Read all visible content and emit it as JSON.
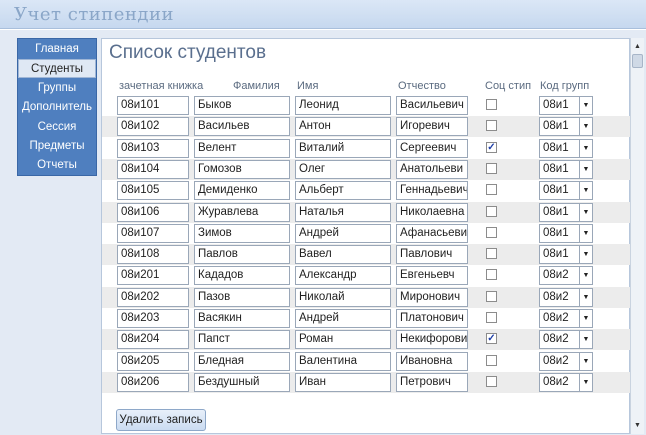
{
  "app": {
    "title": "Учет стипендии"
  },
  "nav": {
    "items": [
      {
        "label": "Главная",
        "active": false
      },
      {
        "label": "Студенты",
        "active": true
      },
      {
        "label": "Группы",
        "active": false
      },
      {
        "label": "Дополнитель",
        "active": false
      },
      {
        "label": "Сессия",
        "active": false
      },
      {
        "label": "Предметы",
        "active": false
      },
      {
        "label": "Отчеты",
        "active": false
      }
    ]
  },
  "form": {
    "title": "Список студентов",
    "columns": [
      "зачетная книжка",
      "Фамилия",
      "Имя",
      "Отчество",
      "Соц стип",
      "Код групп"
    ],
    "delete_label": "Удалить запись",
    "rows": [
      {
        "book": "08и101",
        "last": "Быков",
        "first": "Леонид",
        "middle": "Васильевич",
        "soc": false,
        "group": "08и1"
      },
      {
        "book": "08и102",
        "last": "Васильев",
        "first": "Антон",
        "middle": "Игоревич",
        "soc": false,
        "group": "08и1"
      },
      {
        "book": "08и103",
        "last": "Велент",
        "first": "Виталий",
        "middle": "Сергеевич",
        "soc": true,
        "group": "08и1"
      },
      {
        "book": "08и104",
        "last": "Гомозов",
        "first": "Олег",
        "middle": "Анатольеви",
        "soc": false,
        "group": "08и1"
      },
      {
        "book": "08и105",
        "last": "Демиденко",
        "first": "Альберт",
        "middle": "Геннадьевич",
        "soc": false,
        "group": "08и1"
      },
      {
        "book": "08и106",
        "last": "Журавлева",
        "first": "Наталья",
        "middle": "Николаевна",
        "soc": false,
        "group": "08и1"
      },
      {
        "book": "08и107",
        "last": "Зимов",
        "first": "Андрей",
        "middle": "Афанасьевич",
        "soc": false,
        "group": "08и1"
      },
      {
        "book": "08и108",
        "last": "Павлов",
        "first": "Вавел",
        "middle": "Павлович",
        "soc": false,
        "group": "08и1"
      },
      {
        "book": "08и201",
        "last": "Кададов",
        "first": "Александр",
        "middle": "Евгеньевч",
        "soc": false,
        "group": "08и2"
      },
      {
        "book": "08и202",
        "last": "Пазов",
        "first": "Николай",
        "middle": "Миронович",
        "soc": false,
        "group": "08и2"
      },
      {
        "book": "08и203",
        "last": "Васякин",
        "first": "Андрей",
        "middle": "Платонович",
        "soc": false,
        "group": "08и2"
      },
      {
        "book": "08и204",
        "last": "Папст",
        "first": "Роман",
        "middle": "Некифорови",
        "soc": true,
        "group": "08и2"
      },
      {
        "book": "08и205",
        "last": "Бледная",
        "first": "Валентина",
        "middle": "Ивановна",
        "soc": false,
        "group": "08и2"
      },
      {
        "book": "08и206",
        "last": "Бездушный",
        "first": "Иван",
        "middle": "Петрович",
        "soc": false,
        "group": "08и2"
      }
    ]
  }
}
